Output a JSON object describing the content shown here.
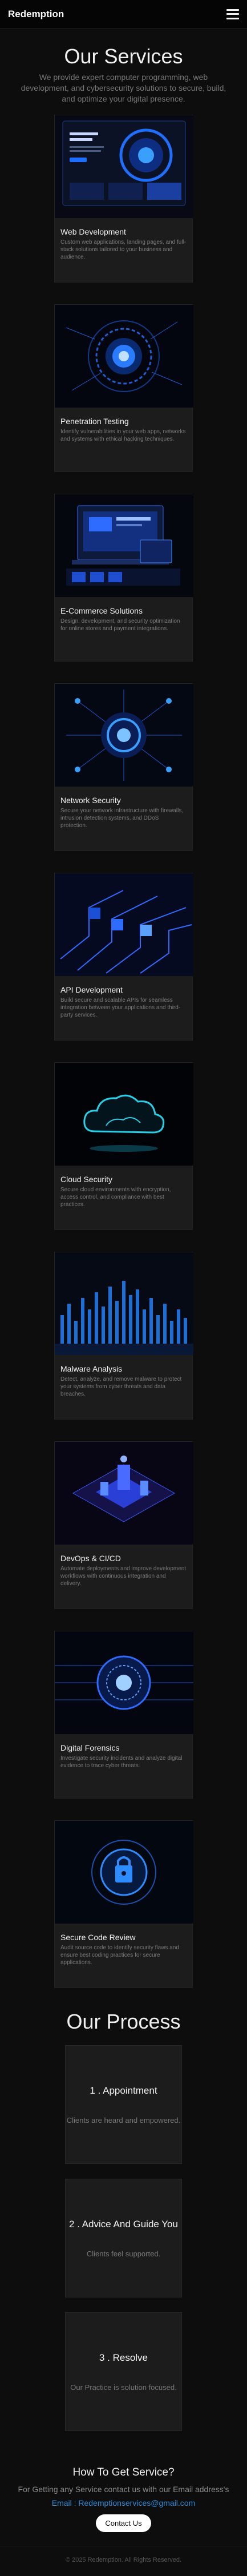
{
  "nav": {
    "brand": "Redemption",
    "menu_icon": "hamburger-menu-icon"
  },
  "services": {
    "title": "Our Services",
    "subtitle": "We provide expert computer programming, web development, and cybersecurity solutions to secure, build, and optimize your digital presence.",
    "items": [
      {
        "title": "Web Development",
        "desc": "Custom web applications, landing pages, and full-stack solutions tailored to your business and audience.",
        "image": "web-development-image"
      },
      {
        "title": "Penetration Testing",
        "desc": "Identify vulnerabilities in your web apps, networks and systems with ethical hacking techniques.",
        "image": "penetration-testing-image"
      },
      {
        "title": "E-Commerce Solutions",
        "desc": "Design, development, and security optimization for online stores and payment integrations.",
        "image": "ecommerce-image"
      },
      {
        "title": "Network Security",
        "desc": "Secure your network infrastructure with firewalls, intrusion detection systems, and DDoS protection.",
        "image": "network-security-image"
      },
      {
        "title": "API Development",
        "desc": "Build secure and scalable APIs for seamless integration between your applications and third-party services.",
        "image": "api-development-image"
      },
      {
        "title": "Cloud Security",
        "desc": "Secure cloud environments with encryption, access control, and compliance with best practices.",
        "image": "cloud-security-image"
      },
      {
        "title": "Malware Analysis",
        "desc": "Detect, analyze, and remove malware to protect your systems from cyber threats and data breaches.",
        "image": "malware-analysis-image"
      },
      {
        "title": "DevOps & CI/CD",
        "desc": "Automate deployments and improve development workflows with continuous integration and delivery.",
        "image": "devops-image"
      },
      {
        "title": "Digital Forensics",
        "desc": "Investigate security incidents and analyze digital evidence to trace cyber threats.",
        "image": "digital-forensics-image"
      },
      {
        "title": "Secure Code Review",
        "desc": "Audit source code to identify security flaws and ensure best coding practices for secure applications.",
        "image": "secure-code-review-image"
      }
    ]
  },
  "process": {
    "title": "Our Process",
    "steps": [
      {
        "title": "1 . Appointment",
        "desc": "Clients are heard and empowered."
      },
      {
        "title": "2 . Advice And Guide You",
        "desc": "Clients feel supported."
      },
      {
        "title": "3 . Resolve",
        "desc": "Our Practice is solution focused."
      }
    ]
  },
  "contact": {
    "title": "How To Get Service?",
    "text": "For Getting any Service contact us with our Email address's",
    "email": "Email : Redemptionservices@gmail.com",
    "button": "Contact Us"
  },
  "footer": {
    "text": "© 2025 Redemption. All Rights Reserved."
  },
  "colors": {
    "background": "#0d0d0d",
    "card": "#1c1c1c",
    "accent_blue": "#2e8bd6",
    "button_bg": "#ffffff"
  }
}
